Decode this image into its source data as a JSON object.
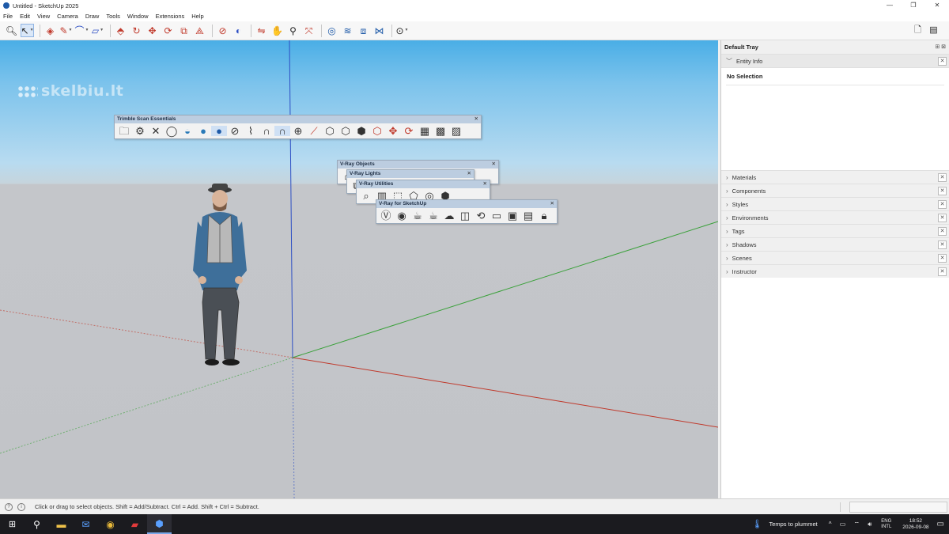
{
  "window": {
    "title": "Untitled - SketchUp 2025",
    "controls": [
      "—",
      "❐",
      "✕"
    ]
  },
  "menubar": [
    "File",
    "Edit",
    "View",
    "Camera",
    "Draw",
    "Tools",
    "Window",
    "Extensions",
    "Help"
  ],
  "watermark": "skelbiu.lt",
  "floating_toolbars": {
    "trimble": {
      "title": "Trimble Scan Essentials",
      "close": "✕"
    },
    "vray_objects": {
      "title": "V-Ray Objects",
      "close": "✕"
    },
    "vray_lights": {
      "title": "V-Ray Lights",
      "close": "✕"
    },
    "vray_utilities": {
      "title": "V-Ray Utilities",
      "close": "✕"
    },
    "vray_sketchup": {
      "title": "V-Ray for SketchUp",
      "close": "✕"
    }
  },
  "tray": {
    "title": "Default Tray",
    "controls": "⊞ ⊠",
    "entity_info": {
      "label": "Entity Info",
      "selection": "No Selection"
    },
    "panels": [
      "Materials",
      "Components",
      "Styles",
      "Environments",
      "Tags",
      "Shadows",
      "Scenes",
      "Instructor"
    ]
  },
  "status": {
    "message": "Click or drag to select objects. Shift = Add/Subtract. Ctrl = Add. Shift + Ctrl = Subtract."
  },
  "taskbar": {
    "weather": "Temps to plummet",
    "lang_top": "ENG",
    "lang_bottom": "INTL",
    "time": "18:52",
    "date": "2026-09-08"
  },
  "colors": {
    "x_axis": "#c0392b",
    "y_axis": "#3aa13a",
    "z_axis": "#2d4fc4",
    "sky": "#4aaee6",
    "ground": "#c2c4c8"
  }
}
